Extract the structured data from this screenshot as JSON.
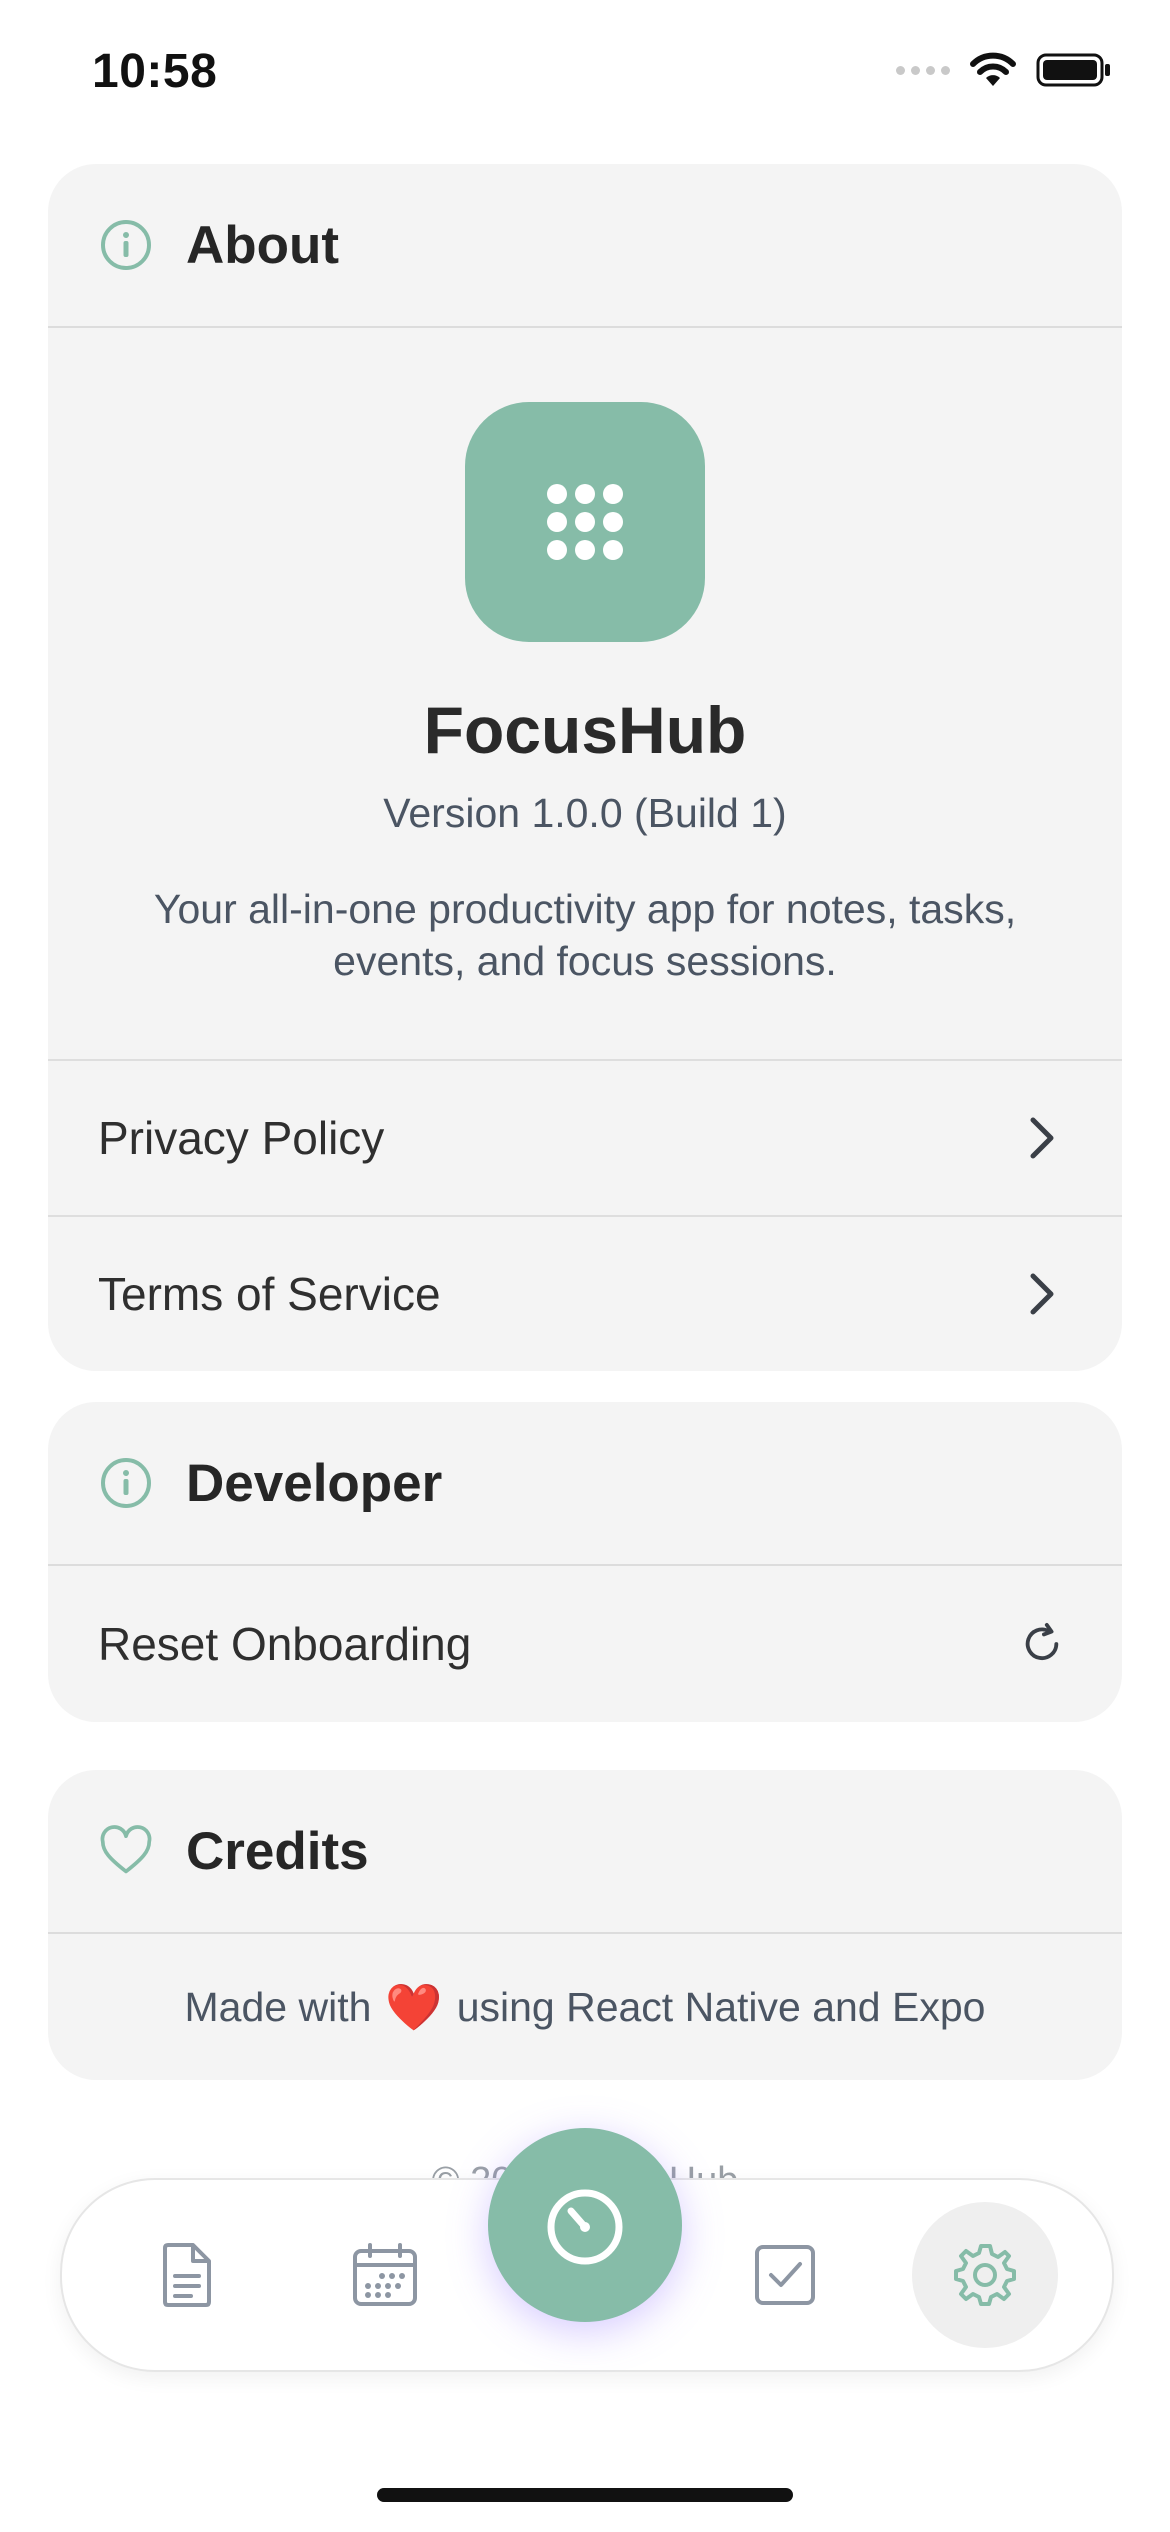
{
  "status_bar": {
    "time": "10:58"
  },
  "about": {
    "title": "About",
    "app_name": "FocusHub",
    "version": "Version 1.0.0 (Build 1)",
    "description": "Your all-in-one productivity app for notes, tasks, events, and focus sessions.",
    "rows": [
      {
        "label": "Privacy Policy",
        "icon": "chevron-right-icon"
      },
      {
        "label": "Terms of Service",
        "icon": "chevron-right-icon"
      }
    ]
  },
  "developer": {
    "title": "Developer",
    "rows": [
      {
        "label": "Reset Onboarding",
        "icon": "refresh-icon"
      }
    ]
  },
  "credits": {
    "title": "Credits",
    "text_before": "Made with",
    "heart": "❤️",
    "text_after": "using React Native and Expo"
  },
  "footnote": "© 2025 FocusHub",
  "tab_bar": {
    "tabs": [
      {
        "icon": "notes-icon"
      },
      {
        "icon": "calendar-icon"
      },
      {
        "icon": "timer-icon",
        "center": true
      },
      {
        "icon": "tasks-icon"
      },
      {
        "icon": "settings-icon",
        "active": true
      }
    ]
  },
  "colors": {
    "accent": "#86bca8",
    "card_bg": "#f4f4f4",
    "text_muted": "#4b5563"
  }
}
